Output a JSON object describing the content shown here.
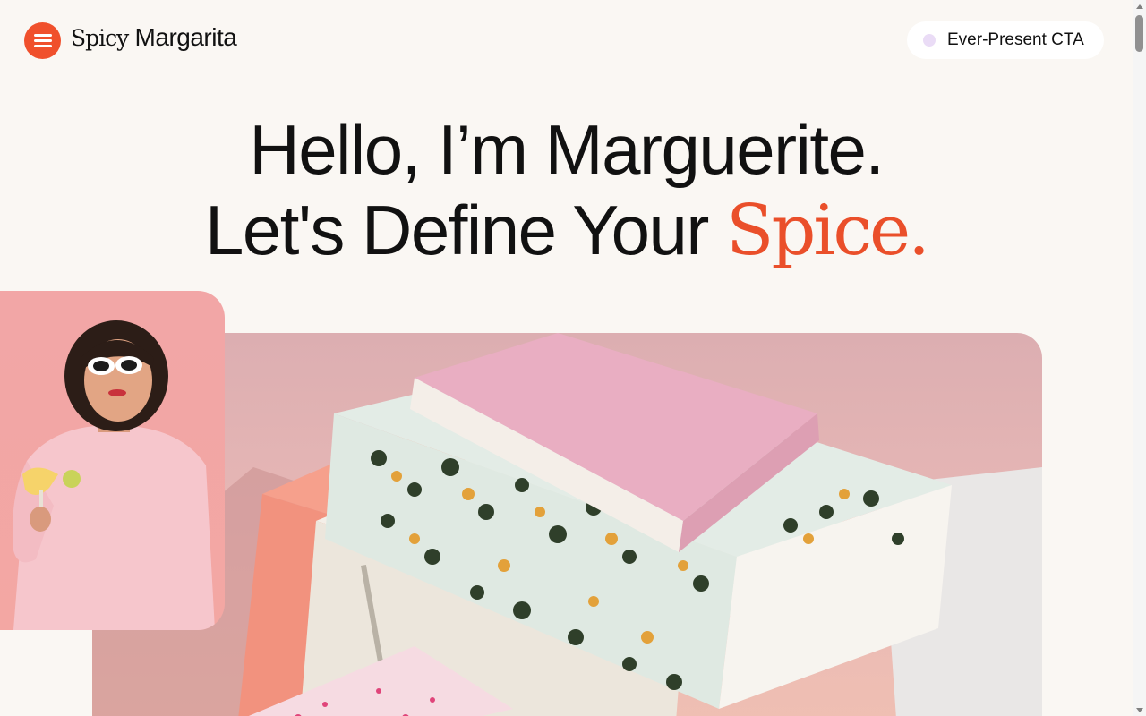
{
  "header": {
    "menu_icon": "hamburger-menu-icon",
    "logo_word1": "Spicy",
    "logo_word2": "Margarita",
    "cta_label": "Ever-Present CTA"
  },
  "hero": {
    "line1": "Hello, I’m Marguerite.",
    "line2_prefix": "Let's Define Your ",
    "line2_accent": "Spice."
  },
  "colors": {
    "accent": "#ea4f2a",
    "menu_button": "#f0502c",
    "background": "#faf7f3",
    "cta_dot": "#eadcf6"
  },
  "images": {
    "portrait": "photo-woman-pink-sweater-margarita",
    "books": "photo-stacked-books-leopard-pink"
  }
}
